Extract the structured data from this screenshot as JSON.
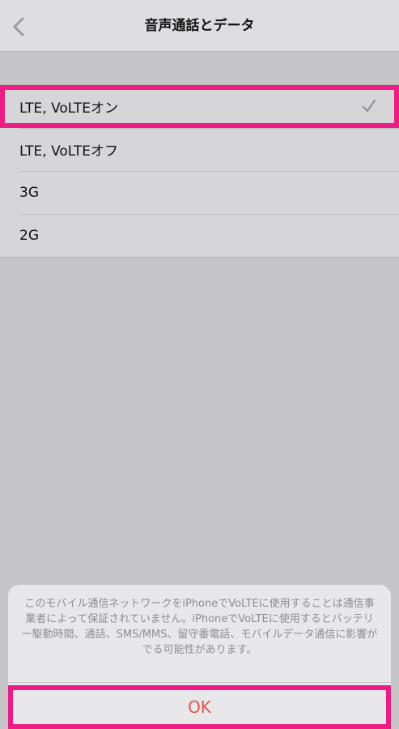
{
  "nav": {
    "title": "音声通話とデータ",
    "back_icon": "chevron-left-icon"
  },
  "options": [
    {
      "label": "LTE, VoLTEオン",
      "selected": true
    },
    {
      "label": "LTE, VoLTEオフ",
      "selected": false
    },
    {
      "label": "3G",
      "selected": false
    },
    {
      "label": "2G",
      "selected": false
    }
  ],
  "alert": {
    "message": "このモバイル通信ネットワークをiPhoneでVoLTEに使用することは通信事業者によって保証されていません。iPhoneでVoLTEに使用するとバッテリー駆動時間、通話、SMS/MMS、留守番電話、モバイルデータ通信に影響がでる可能性があります。",
    "ok_label": "OK"
  },
  "colors": {
    "highlight": "#ee1c84",
    "ok_text": "#e8524a",
    "check": "#8e8e93"
  }
}
